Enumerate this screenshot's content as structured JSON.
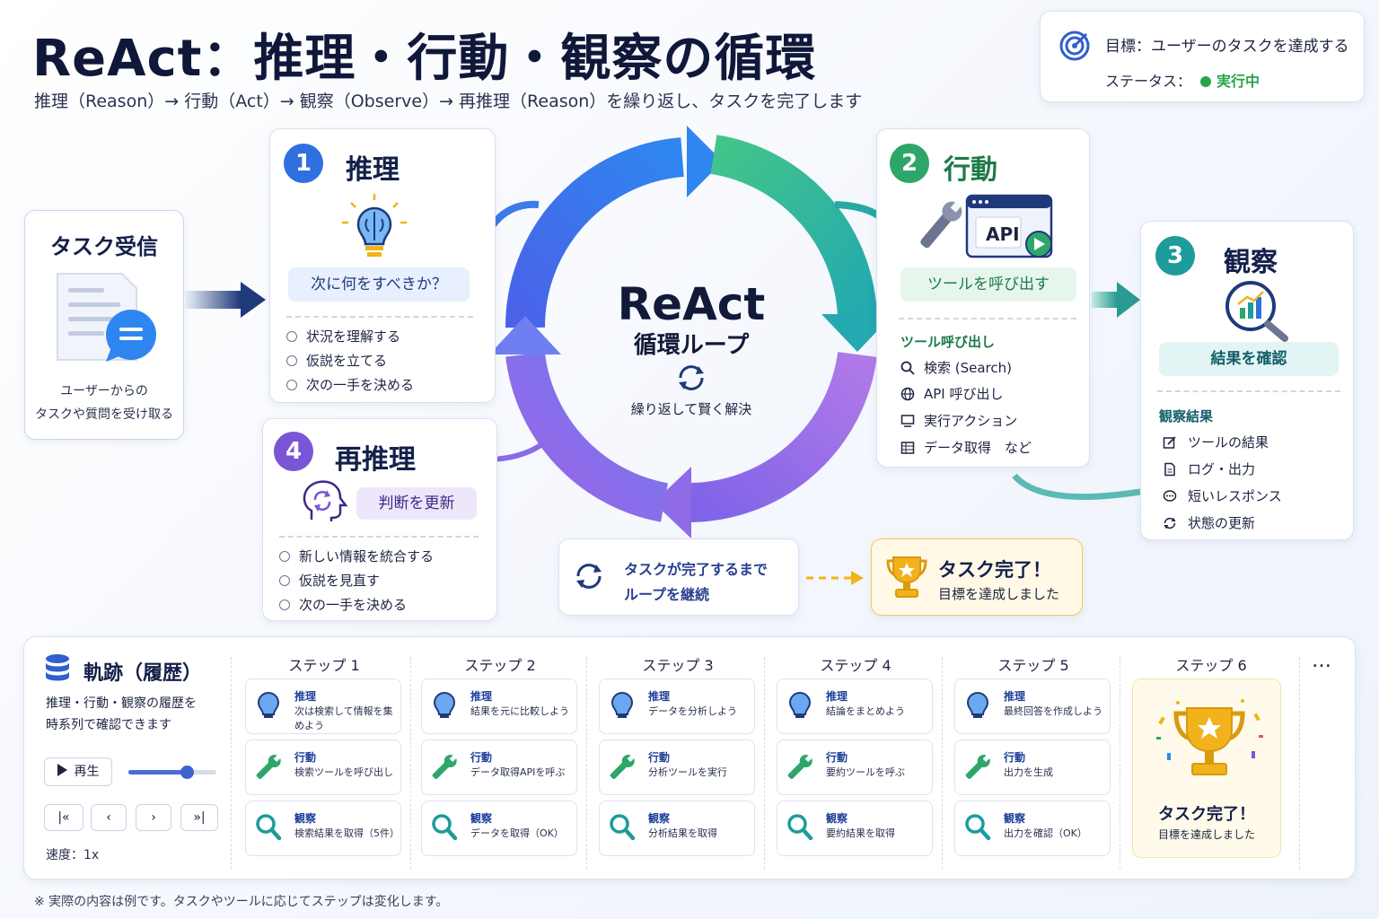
{
  "title": "ReAct：推理・行動・観察の循環",
  "subtitle": "推理（Reason）→ 行動（Act）→ 観察（Observe）→ 再推理（Reason）を繰り返し、タスクを完了します",
  "goal": {
    "label": "目標：ユーザーのタスクを達成する",
    "status_label": "ステータス：",
    "status_value": "実行中"
  },
  "task_receive": {
    "title": "タスク受信",
    "desc1": "ユーザーからの",
    "desc2": "タスクや質問を受け取る"
  },
  "reason": {
    "num": "1",
    "title": "推理",
    "pill": "次に何をすべきか？",
    "items": [
      "状況を理解する",
      "仮説を立てる",
      "次の一手を決める"
    ]
  },
  "act": {
    "num": "2",
    "title": "行動",
    "api_label": "API",
    "pill": "ツールを呼び出す",
    "list_title": "ツール呼び出し",
    "items": [
      "検索 (Search)",
      "API 呼び出し",
      "実行アクション",
      "データ取得　など"
    ]
  },
  "observe": {
    "num": "3",
    "title": "観察",
    "pill": "結果を確認",
    "list_title": "観察結果",
    "items": [
      "ツールの結果",
      "ログ・出力",
      "短いレスポンス",
      "状態の更新"
    ]
  },
  "rereason": {
    "num": "4",
    "title": "再推理",
    "pill": "判断を更新",
    "items": [
      "新しい情報を統合する",
      "仮説を見直す",
      "次の一手を決める"
    ]
  },
  "loop": {
    "name": "ReAct",
    "sub": "循環ループ",
    "caption": "繰り返して賢く解決"
  },
  "continue_text": {
    "line1": "タスクが完了するまで",
    "line2": "ループを継続"
  },
  "done": {
    "title": "タスク完了！",
    "desc": "目標を達成しました"
  },
  "trajectory": {
    "title": "軌跡（履歴）",
    "desc1": "推理・行動・観察の履歴を",
    "desc2": "時系列で確認できます",
    "play": "再生",
    "speed": "速度：1x",
    "more": "…",
    "labels": {
      "reason": "推理",
      "act": "行動",
      "observe": "観察"
    },
    "steps": [
      {
        "name": "ステップ 1",
        "reason": "次は検索して情報を集めよう",
        "act": "検索ツールを呼び出し",
        "observe": "検索結果を取得（5件）"
      },
      {
        "name": "ステップ 2",
        "reason": "結果を元に比較しよう",
        "act": "データ取得APIを呼ぶ",
        "observe": "データを取得（OK）"
      },
      {
        "name": "ステップ 3",
        "reason": "データを分析しよう",
        "act": "分析ツールを実行",
        "observe": "分析結果を取得"
      },
      {
        "name": "ステップ 4",
        "reason": "結論をまとめよう",
        "act": "要約ツールを呼ぶ",
        "observe": "要約結果を取得"
      },
      {
        "name": "ステップ 5",
        "reason": "最終回答を作成しよう",
        "act": "出力を生成",
        "observe": "出力を確認（OK）"
      }
    ],
    "final": {
      "name": "ステップ 6",
      "title": "タスク完了！",
      "desc": "目標を達成しました"
    }
  },
  "note": "※ 実際の内容は例です。タスクやツールに応じてステップは変化します。",
  "colors": {
    "reason": "#2f6fe0",
    "act": "#2ea66a",
    "observe": "#1e9b9b",
    "rereason": "#7a55d6",
    "gold": "#f2b21c"
  }
}
